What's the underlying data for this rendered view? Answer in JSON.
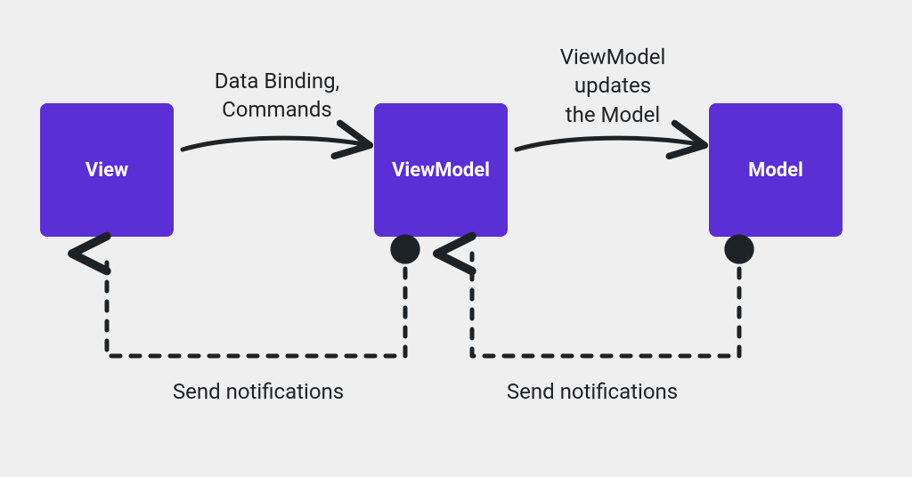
{
  "boxes": {
    "view": "View",
    "viewmodel": "ViewModel",
    "model": "Model"
  },
  "labels": {
    "top_left": "Data Binding,\nCommands",
    "top_right": "ViewModel\nupdates\nthe Model",
    "bottom_left": "Send notifications",
    "bottom_right": "Send notifications"
  },
  "colors": {
    "box_fill": "#5a2fd6",
    "stroke": "#1d2226",
    "bg": "#efefef"
  }
}
